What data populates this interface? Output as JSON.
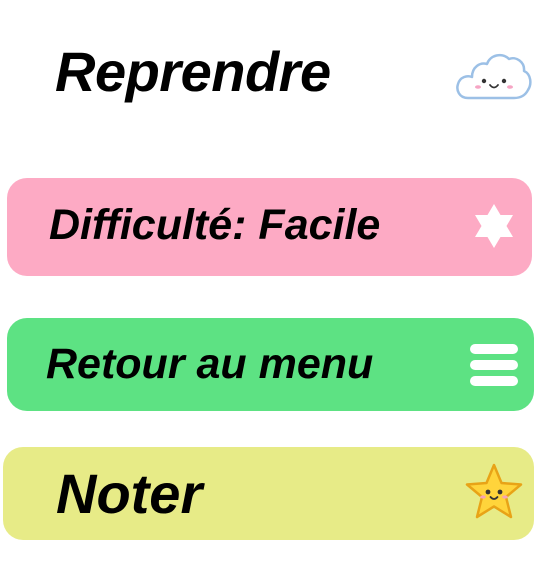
{
  "title": "Reprendre",
  "colors": {
    "difficulty_button": "#FDAAC4",
    "menu_button": "#5DE283",
    "rate_button": "#E7EB87",
    "star": "#FFD43B",
    "cloud_outline": "#9CC0E6"
  },
  "buttons": {
    "difficulty": {
      "label": "Difficulté: Facile",
      "icon": "six-point-star-icon"
    },
    "menu": {
      "label": "Retour au menu",
      "icon": "hamburger-menu-icon"
    },
    "rate": {
      "label": "Noter",
      "icon": "smiling-star-icon"
    }
  },
  "decor": {
    "cloud_icon": "smiling-cloud-icon"
  }
}
